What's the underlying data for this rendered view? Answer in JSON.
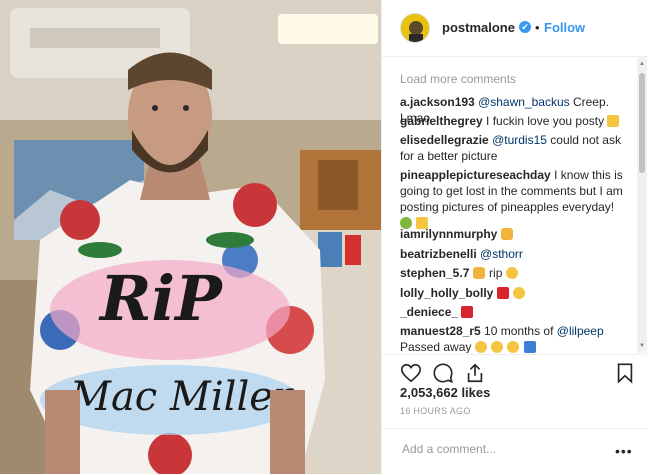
{
  "post": {
    "username": "postmalone",
    "verified_mark": "✔",
    "separator": "•",
    "follow_label": "Follow"
  },
  "comments": {
    "load_more": "Load more comments",
    "items": [
      {
        "user": "a.jackson193",
        "mention": "@shawn_backus",
        "text": " Creep. Lmao"
      },
      {
        "user": "gabrielthegrey",
        "text": " I fuckin love you posty"
      },
      {
        "user": "elisedellegrazie",
        "mention": "@turdis15",
        "text": " could not ask for a better picture"
      },
      {
        "user": "pineapplepictureseachday",
        "text": " I know this is going to get lost in the comments but I am posting pictures of pineapples everyday!"
      },
      {
        "user": "iamrilynnmurphy",
        "text": " "
      },
      {
        "user": "beatrizbenelli",
        "mention": "@sthorr",
        "text": ""
      },
      {
        "user": "stephen_5.7",
        "text": " rip"
      },
      {
        "user": "lolly_holly_bolly",
        "text": " "
      },
      {
        "user": "_deniece_",
        "text": " "
      },
      {
        "user": "manuest28_r5",
        "text": " 10 months of ",
        "mention": "@lilpeep",
        "text2": "Passed away"
      }
    ]
  },
  "stats": {
    "likes": "2,053,662 likes",
    "time": "16 HOURS AGO"
  },
  "add_comment": {
    "placeholder": "Add a comment...",
    "more": "•••"
  },
  "icons": {
    "like": "heart-icon",
    "comment": "comment-icon",
    "share": "share-icon",
    "save": "bookmark-icon"
  },
  "colors": {
    "link_blue": "#3897f0",
    "mention_blue": "#003569",
    "muted": "#999999"
  }
}
